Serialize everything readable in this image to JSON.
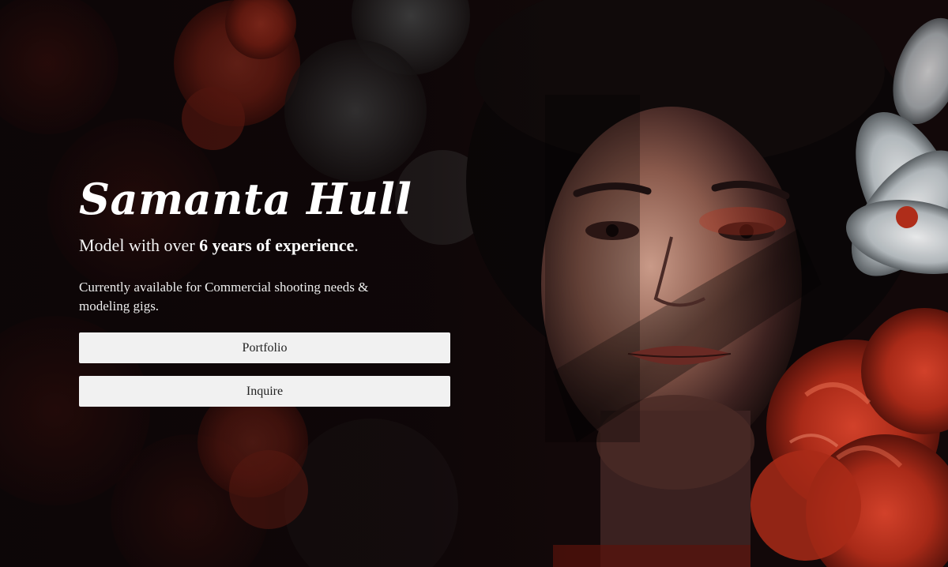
{
  "hero": {
    "name": "Samanta Hull",
    "tagline_prefix": "Model with over ",
    "tagline_highlight": "6 years of experience",
    "tagline_suffix": ".",
    "availability": "Currently available for Commercial shooting needs & modeling gigs."
  },
  "actions": {
    "portfolio_label": "Portfolio",
    "inquire_label": "Inquire"
  },
  "colors": {
    "background": "#0b0607",
    "text": "#ffffff",
    "button_bg": "#f1f1f1",
    "button_text": "#222222",
    "flower_red": "#b8301c",
    "flower_white": "#dfe3e6"
  }
}
